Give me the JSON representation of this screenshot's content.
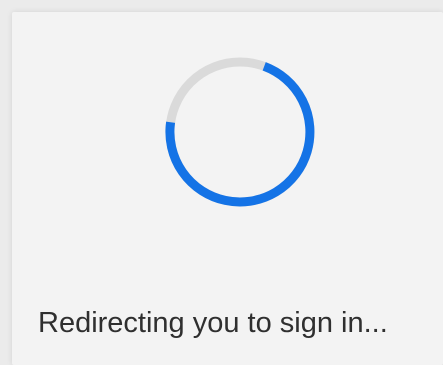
{
  "loading": {
    "message": "Redirecting you to sign in...",
    "spinner_icon": "loading-spinner-icon",
    "colors": {
      "spinner_active": "#1473e6",
      "spinner_track": "#dadada"
    }
  }
}
